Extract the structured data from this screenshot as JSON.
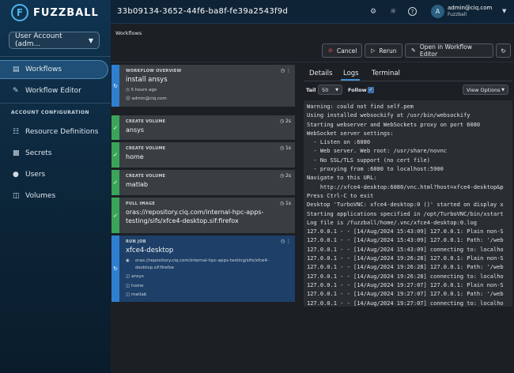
{
  "app": {
    "logo_text": "FUZZBALL",
    "workflow_id": "33b09134-3652-44f6-ba8f-fe39a2543f9d"
  },
  "sidebar": {
    "account_select": "User Account (adm...",
    "nav": [
      {
        "label": "Workflows",
        "icon": "workflows-icon"
      },
      {
        "label": "Workflow Editor",
        "icon": "editor-icon"
      }
    ],
    "section_title": "ACCOUNT CONFIGURATION",
    "config": [
      {
        "label": "Resource Definitions"
      },
      {
        "label": "Secrets"
      },
      {
        "label": "Users"
      },
      {
        "label": "Volumes"
      }
    ]
  },
  "user": {
    "email": "admin@ciq.com",
    "org": "Fuzzball",
    "initial": "A"
  },
  "breadcrumb": "Workflows",
  "toolbar": {
    "cancel": "Cancel",
    "rerun": "Rerun",
    "open_editor": "Open in Workflow Editor"
  },
  "steps": [
    {
      "kind": "WORKFLOW OVERVIEW",
      "name": "install ansys",
      "time": "5 hours ago",
      "user": "admin@ciq.com"
    },
    {
      "kind": "CREATE VOLUME",
      "name": "ansys",
      "dur": "2s"
    },
    {
      "kind": "CREATE VOLUME",
      "name": "home",
      "dur": "1s"
    },
    {
      "kind": "CREATE VOLUME",
      "name": "matlab",
      "dur": "2s"
    },
    {
      "kind": "PULL IMAGE",
      "name": "oras://repository.ciq.com/internal-hpc-apps-testing/sifs/xfce4-desktop.sif:firefox",
      "dur": "1s"
    },
    {
      "kind": "RUN JOB",
      "name": "xfce4-desktop",
      "image": "oras://repository.ciq.com/internal-hpc-apps-testing/sifs/xfce4-desktop.sif:firefox",
      "volumes": [
        "ansys",
        "home",
        "matlab"
      ]
    }
  ],
  "tabs": [
    "Details",
    "Logs",
    "Terminal"
  ],
  "log_controls": {
    "tail_label": "Tail",
    "tail_value": "50",
    "follow_label": "Follow",
    "view_options": "View Options"
  },
  "log_lines": [
    "Warning: could not find self.pem",
    "Using installed websockify at /usr/bin/websockify",
    "Starting webserver and WebSockets proxy on port 6080",
    "WebSocket server settings:",
    "  - Listen on :6080",
    "  - Web server. Web root: /usr/share/novnc",
    "  - No SSL/TLS support (no cert file)",
    "  - proxying from :6080 to localhost:5900",
    "Navigate to this URL:",
    "    http://xfce4-desktop:6080/vnc.html?host=xfce4-desktop&p",
    "Press Ctrl-C to exit",
    "Desktop 'TurboVNC: xfce4-desktop:0 ()' started on display x",
    "Starting applications specified in /opt/TurboVNC/bin/xstart",
    "Log file is /fuzzball/home/.vnc/xfce4-desktop:0.log",
    "127.0.0.1 - - [14/Aug/2024 15:43:09] 127.0.0.1: Plain non-S",
    "127.0.0.1 - - [14/Aug/2024 15:43:09] 127.0.0.1: Path: '/web",
    "127.0.0.1 - - [14/Aug/2024 15:43:09] connecting to: localho",
    "127.0.0.1 - - [14/Aug/2024 19:26:28] 127.0.0.1: Plain non-S",
    "127.0.0.1 - - [14/Aug/2024 19:26:28] 127.0.0.1: Path: '/web",
    "127.0.0.1 - - [14/Aug/2024 19:26:28] connecting to: localho",
    "127.0.0.1 - - [14/Aug/2024 19:27:07] 127.0.0.1: Plain non-S",
    "127.0.0.1 - - [14/Aug/2024 19:27:07] 127.0.0.1: Path: '/web",
    "127.0.0.1 - - [14/Aug/2024 19:27:07] connecting to: localho"
  ],
  "colors": {
    "sidebar": "#0f3350",
    "running": "#2f7fd0",
    "success": "#3aa55a",
    "run_card": "#1e3f68"
  }
}
